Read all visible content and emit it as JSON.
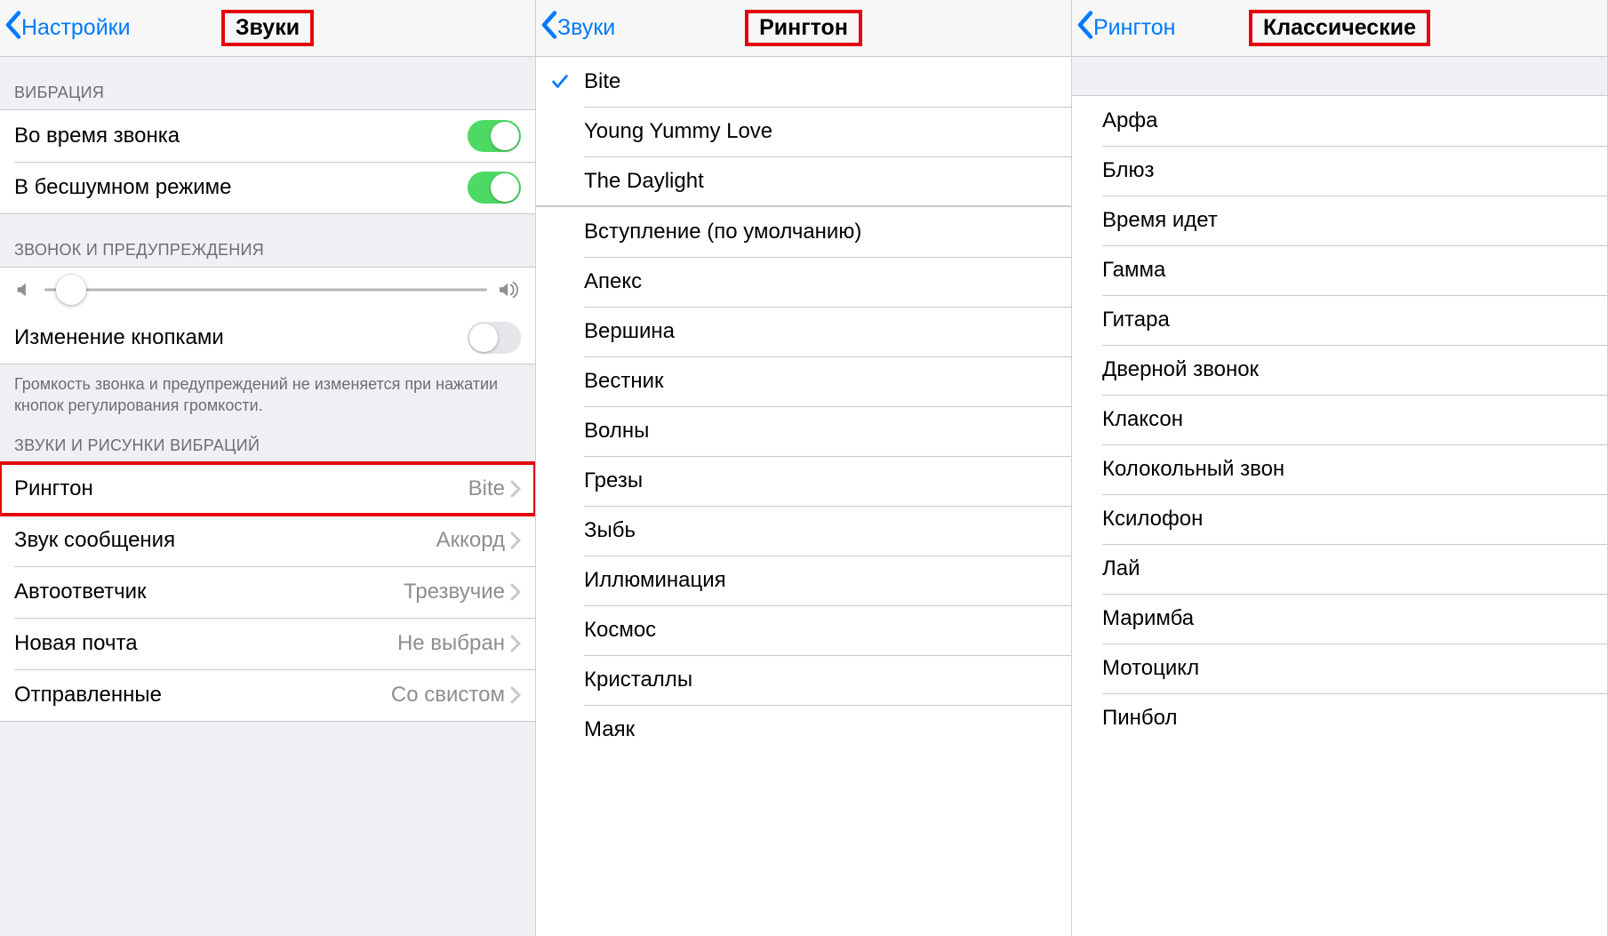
{
  "panel1": {
    "back": "Настройки",
    "title": "Звуки",
    "sections": {
      "vibration_header": "ВИБРАЦИЯ",
      "vibrate_on_ring": "Во время звонка",
      "vibrate_on_silent": "В бесшумном режиме",
      "ringer_header": "ЗВОНОК И ПРЕДУПРЕЖДЕНИЯ",
      "change_with_buttons": "Изменение кнопками",
      "footer": "Громкость звонка и предупреждений не изменяется при нажатии кнопок регулирования громкости.",
      "sounds_header": "ЗВУКИ И РИСУНКИ ВИБРАЦИЙ",
      "rows": {
        "ringtone": {
          "label": "Рингтон",
          "value": "Bite"
        },
        "text_tone": {
          "label": "Звук сообщения",
          "value": "Аккорд"
        },
        "voicemail": {
          "label": "Автоответчик",
          "value": "Трезвучие"
        },
        "new_mail": {
          "label": "Новая почта",
          "value": "Не выбран"
        },
        "sent_mail": {
          "label": "Отправленные",
          "value": "Со свистом"
        }
      }
    },
    "toggles": {
      "vibrate_on_ring": true,
      "vibrate_on_silent": true,
      "change_with_buttons": false
    },
    "slider_value_pct": 6
  },
  "panel2": {
    "back": "Звуки",
    "title": "Рингтон",
    "selected": "Bite",
    "custom": [
      "Bite",
      "Young Yummy Love",
      "The Daylight"
    ],
    "builtin": [
      "Вступление (по умолчанию)",
      "Апекс",
      "Вершина",
      "Вестник",
      "Волны",
      "Грезы",
      "Зыбь",
      "Иллюминация",
      "Космос",
      "Кристаллы",
      "Маяк"
    ]
  },
  "panel3": {
    "back": "Рингтон",
    "title": "Классические",
    "items": [
      "Арфа",
      "Блюз",
      "Время идет",
      "Гамма",
      "Гитара",
      "Дверной звонок",
      "Клаксон",
      "Колокольный звон",
      "Ксилофон",
      "Лай",
      "Маримба",
      "Мотоцикл",
      "Пинбол"
    ]
  }
}
